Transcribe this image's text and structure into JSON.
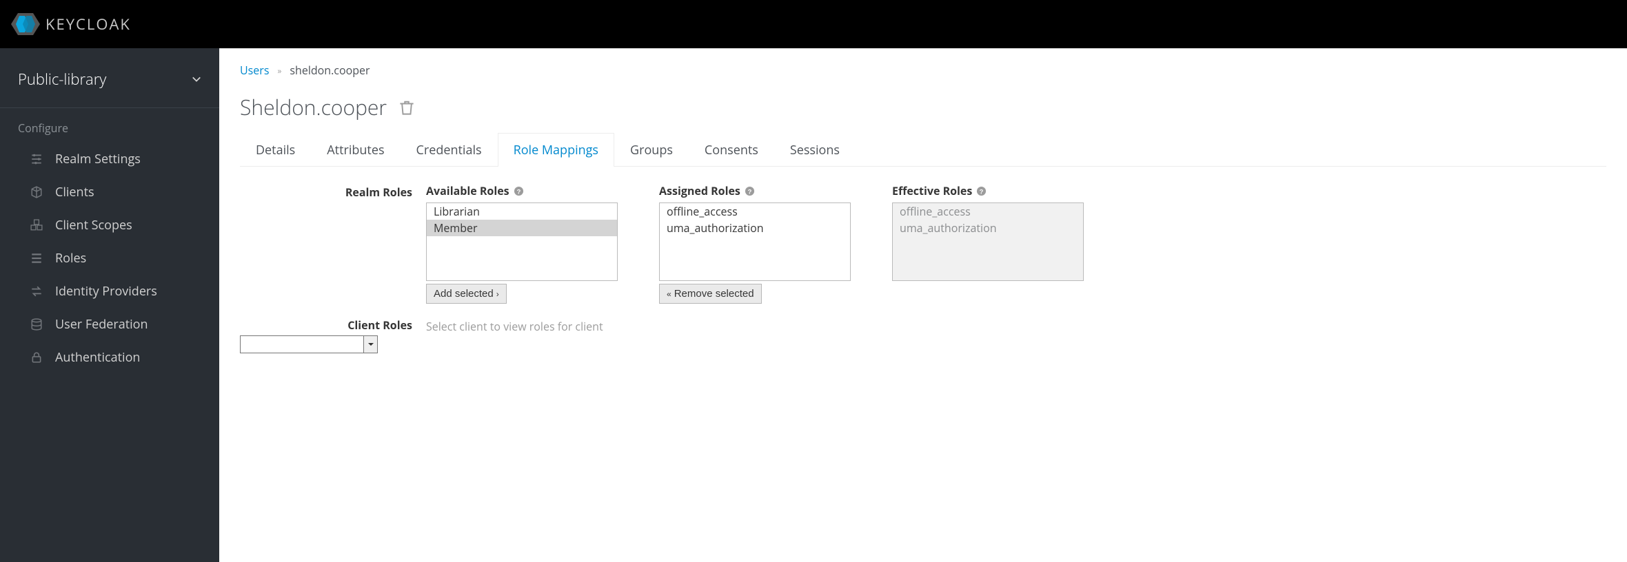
{
  "brand": "KEYCLOAK",
  "realm": {
    "name": "Public-library"
  },
  "sidebar": {
    "section": "Configure",
    "items": [
      {
        "label": "Realm Settings"
      },
      {
        "label": "Clients"
      },
      {
        "label": "Client Scopes"
      },
      {
        "label": "Roles"
      },
      {
        "label": "Identity Providers"
      },
      {
        "label": "User Federation"
      },
      {
        "label": "Authentication"
      }
    ]
  },
  "breadcrumb": {
    "parent": "Users",
    "current": "sheldon.cooper"
  },
  "page": {
    "title": "Sheldon.cooper"
  },
  "tabs": [
    {
      "label": "Details"
    },
    {
      "label": "Attributes"
    },
    {
      "label": "Credentials"
    },
    {
      "label": "Role Mappings",
      "active": true
    },
    {
      "label": "Groups"
    },
    {
      "label": "Consents"
    },
    {
      "label": "Sessions"
    }
  ],
  "role_mappings": {
    "realm_roles_label": "Realm Roles",
    "available": {
      "label": "Available Roles",
      "options": [
        "Librarian",
        "Member"
      ],
      "selected": "Member",
      "button": "Add selected"
    },
    "assigned": {
      "label": "Assigned Roles",
      "options": [
        "offline_access",
        "uma_authorization"
      ],
      "button": "Remove selected"
    },
    "effective": {
      "label": "Effective Roles",
      "options": [
        "offline_access",
        "uma_authorization"
      ]
    },
    "client_roles_label": "Client Roles",
    "client_hint": "Select client to view roles for client"
  }
}
